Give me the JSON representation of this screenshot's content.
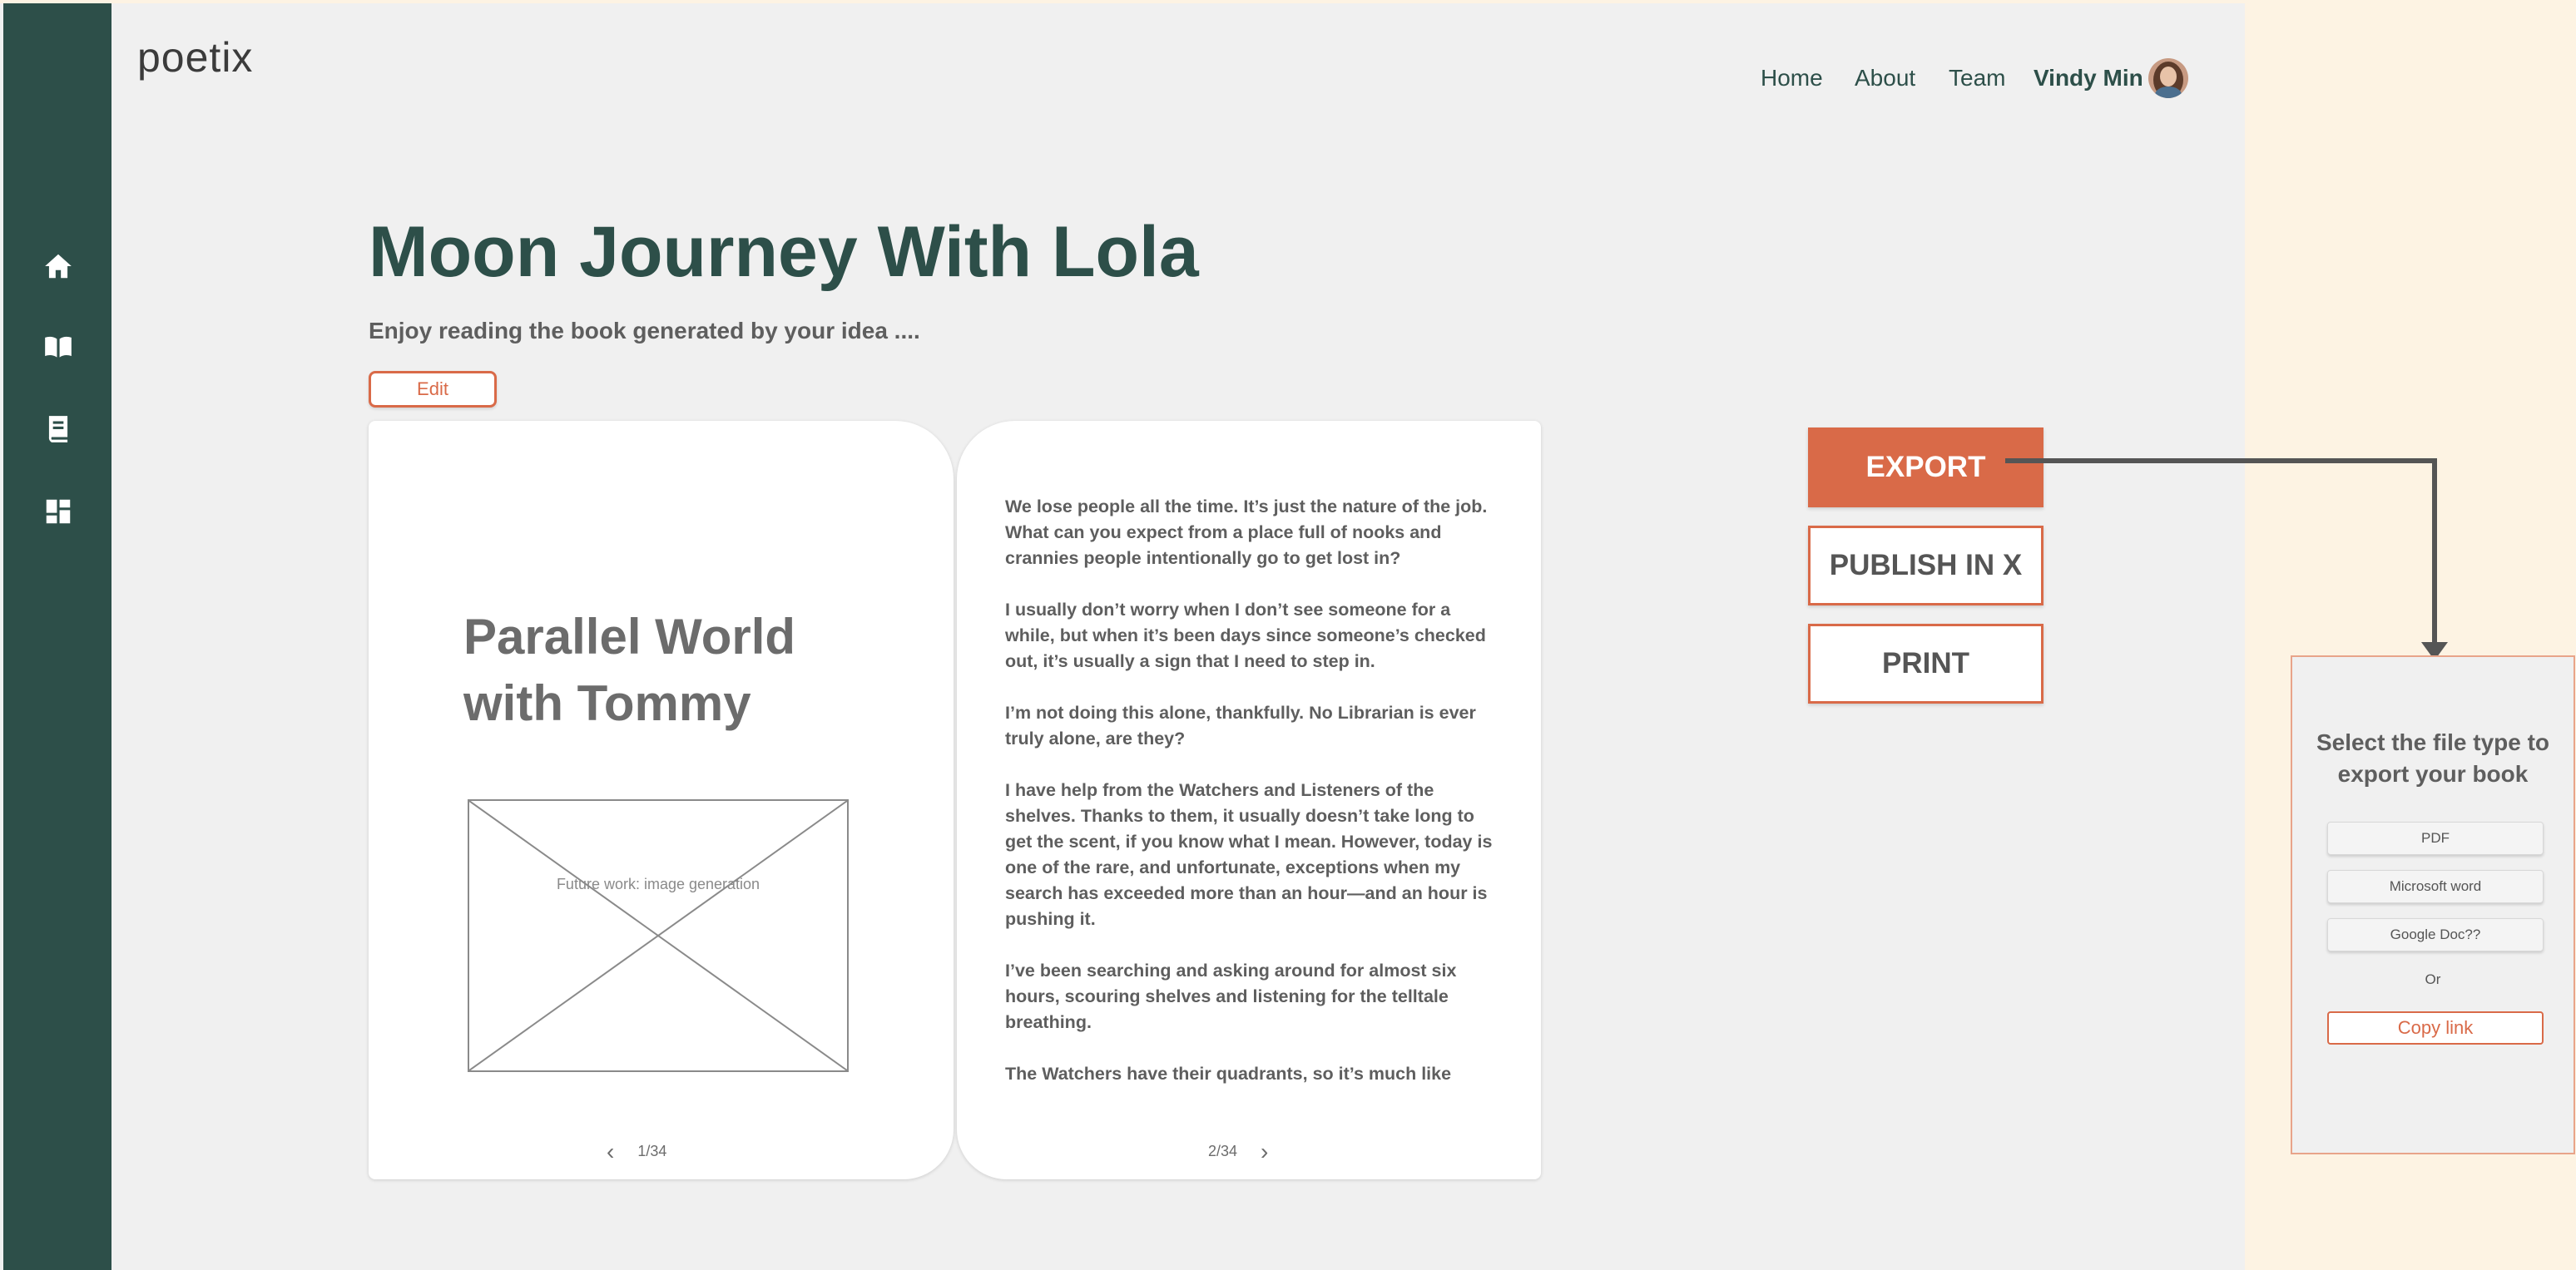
{
  "brand": {
    "logo": "poetix"
  },
  "nav": {
    "home": "Home",
    "about": "About",
    "team": "Team",
    "user_name": "Vindy Min"
  },
  "sidebar": {
    "items": [
      {
        "icon": "home-icon"
      },
      {
        "icon": "book-open-icon"
      },
      {
        "icon": "library-book-icon"
      },
      {
        "icon": "dashboard-icon"
      }
    ]
  },
  "main": {
    "title": "Moon Journey With Lola",
    "subtitle": "Enjoy reading the book generated by your idea ....",
    "edit_label": "Edit"
  },
  "book": {
    "left_page": {
      "heading": "Parallel World with Tommy",
      "image_placeholder": "Future work: image generation",
      "page_indicator": "1/34"
    },
    "right_page": {
      "paragraphs": [
        "We lose people all the time. It’s just the nature of the job. What can you expect from a place full of nooks and crannies people intentionally go to get lost in?",
        "I usually don’t worry when I don’t see someone for a while, but when it’s been days since someone’s checked out, it’s usually a sign that I need to step in.",
        "I’m not doing this alone, thankfully. No Librarian is ever truly alone, are they?",
        "I have help from the Watchers and Listeners of the shelves. Thanks to them, it usually doesn’t take long to get the scent, if you know what I mean. However, today is one of the rare, and unfortunate, exceptions when my search has exceeded more than an hour—and an hour is pushing it.",
        "I’ve been searching and asking around for almost six hours, scouring shelves and listening for the telltale breathing.",
        "The Watchers have their quadrants, so it’s much like"
      ],
      "page_indicator": "2/34"
    }
  },
  "actions": {
    "export": "EXPORT",
    "publish": "PUBLISH IN X",
    "print": "PRINT"
  },
  "export_panel": {
    "title": "Select the file type to export your book",
    "options": [
      "PDF",
      "Microsoft word",
      "Google Doc??"
    ],
    "or": "Or",
    "copy_link": "Copy link"
  },
  "colors": {
    "sidebar": "#2d4f49",
    "accent": "#d96a48",
    "title": "#2d4f49",
    "app_background": "#f0f0f0",
    "page_background": "#fdf3e3"
  }
}
